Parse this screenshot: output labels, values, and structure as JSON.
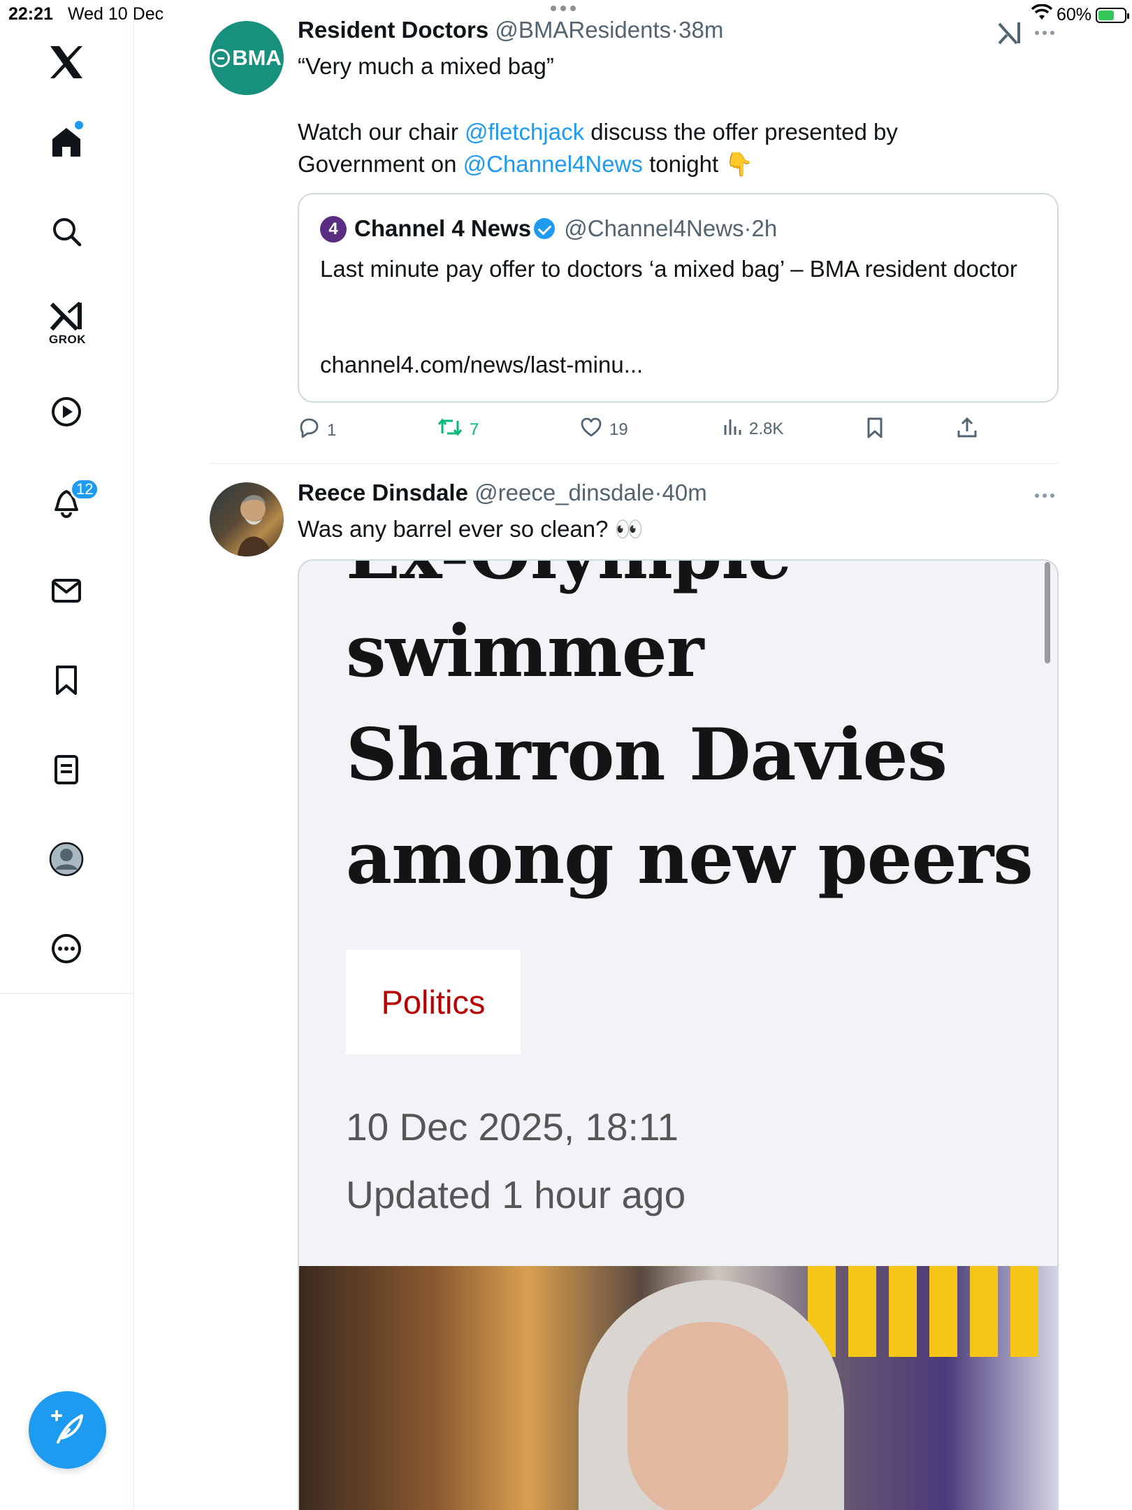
{
  "status_bar": {
    "time": "22:21",
    "date": "Wed 10 Dec",
    "battery": "60%",
    "battery_level": 0.6
  },
  "sidebar": {
    "items": [
      {
        "name": "home",
        "icon": "home-icon"
      },
      {
        "name": "search",
        "icon": "search-icon"
      },
      {
        "name": "grok",
        "icon": "grok-icon",
        "label": "GROK"
      },
      {
        "name": "video",
        "icon": "play-icon"
      },
      {
        "name": "notifications",
        "icon": "bell-icon",
        "badge": "12"
      },
      {
        "name": "messages",
        "icon": "mail-icon"
      },
      {
        "name": "bookmarks",
        "icon": "bookmark-icon"
      },
      {
        "name": "lists",
        "icon": "list-icon"
      },
      {
        "name": "profile",
        "icon": "profile-icon"
      },
      {
        "name": "more",
        "icon": "more-icon"
      }
    ],
    "compose_icon": "feather-plus-icon"
  },
  "tweets": [
    {
      "avatar_text": "BMA",
      "name": "Resident Doctors",
      "handle": "@BMAResidents",
      "sep": "·",
      "time": "38m",
      "text_line1": "“Very much a mixed bag”",
      "text2_a": "Watch our chair ",
      "mention1": "@fletchjack",
      "text2_b": " discuss the offer presented by",
      "text3_a": "Government on ",
      "mention2": "@Channel4News",
      "text3_b": " tonight 👇",
      "quote": {
        "avatar_text": "4",
        "name": "Channel 4 News",
        "handle": "@Channel4News",
        "sep": "·",
        "time": "2h",
        "text": "Last minute pay offer to doctors ‘a mixed bag’ – BMA resident doctor",
        "url": "channel4.com/news/last-minu..."
      },
      "actions": {
        "replies": "1",
        "retweets": "7",
        "likes": "19",
        "views": "2.8K"
      }
    },
    {
      "name": "Reece Dinsdale",
      "handle": "@reece_dinsdale",
      "sep": "·",
      "time": "40m",
      "text": "Was any barrel ever so clean? 👀",
      "article": {
        "headline_cut": "Ex-Olympic",
        "headline_line2": "swimmer",
        "headline_line3": "Sharron Davies",
        "headline_line4": "among new peers",
        "tag": "Politics",
        "date": "10 Dec 2025, 18:11",
        "updated": "Updated 1 hour ago"
      }
    }
  ],
  "colors": {
    "accent": "#1d9bf0",
    "retweet": "#00ba7c",
    "bma_green": "#17917e",
    "bbc_red": "#b80000"
  }
}
